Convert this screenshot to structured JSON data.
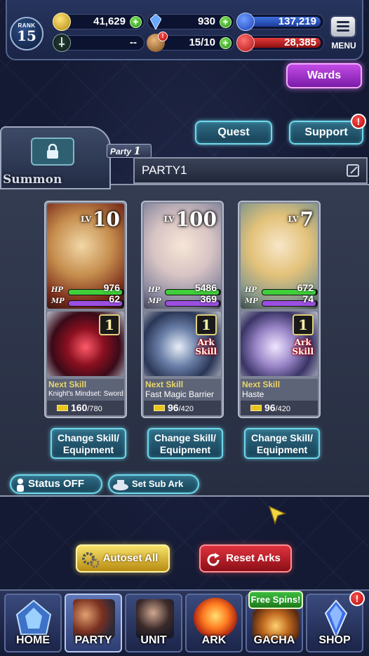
{
  "header": {
    "rank_label": "RANK",
    "rank_value": "15",
    "gold": "41,629",
    "crystals": "930",
    "blue_orbs": "137,219",
    "sword_value": "--",
    "stamina": "15/10",
    "red_orbs": "28,385",
    "menu_label": "MENU"
  },
  "buttons": {
    "wards": "Wards",
    "quest": "Quest",
    "support": "Support",
    "support_badge": "!",
    "autoset_all": "Autoset All",
    "reset_arks": "Reset Arks",
    "status_off": "Status OFF",
    "set_sub_ark": "Set Sub Ark"
  },
  "summon_label": "Summon",
  "party": {
    "tag_prefix": "Party",
    "tag_number": "1",
    "name": "PARTY1"
  },
  "units": [
    {
      "lv_label": "LV",
      "level": "10",
      "hp": "976",
      "mp": "62",
      "ark_level": "1",
      "ark_skill": "",
      "next_skill_label": "Next Skill",
      "next_skill_name": "Knight's Mindset: Sword",
      "progress": "160",
      "progress_max": "/780",
      "change_label_1": "Change Skill/",
      "change_label_2": "Equipment"
    },
    {
      "lv_label": "LV",
      "level": "100",
      "hp": "5486",
      "mp": "369",
      "ark_level": "1",
      "ark_skill_1": "Ark",
      "ark_skill_2": "Skill",
      "next_skill_label": "Next Skill",
      "next_skill_name": "Fast Magic Barrier",
      "progress": "96",
      "progress_max": "/420",
      "change_label_1": "Change Skill/",
      "change_label_2": "Equipment"
    },
    {
      "lv_label": "LV",
      "level": "7",
      "hp": "672",
      "mp": "74",
      "ark_level": "1",
      "ark_skill_1": "Ark",
      "ark_skill_2": "Skill",
      "next_skill_label": "Next Skill",
      "next_skill_name": "Haste",
      "progress": "96",
      "progress_max": "/420",
      "change_label_1": "Change Skill/",
      "change_label_2": "Equipment"
    }
  ],
  "nav": {
    "home": "HOME",
    "party": "PARTY",
    "unit": "UNIT",
    "ark": "ARK",
    "gacha": "GACHA",
    "shop": "SHOP",
    "free_spins": "Free Spins!",
    "shop_badge": "!"
  },
  "colors": {
    "hp": "#3fcf3a",
    "mp": "#9b4fe0",
    "teal_accent": "#6fd8ea",
    "purple_accent": "#c34be6",
    "gold_accent": "#f7e26a",
    "red_accent": "#e0333e"
  }
}
